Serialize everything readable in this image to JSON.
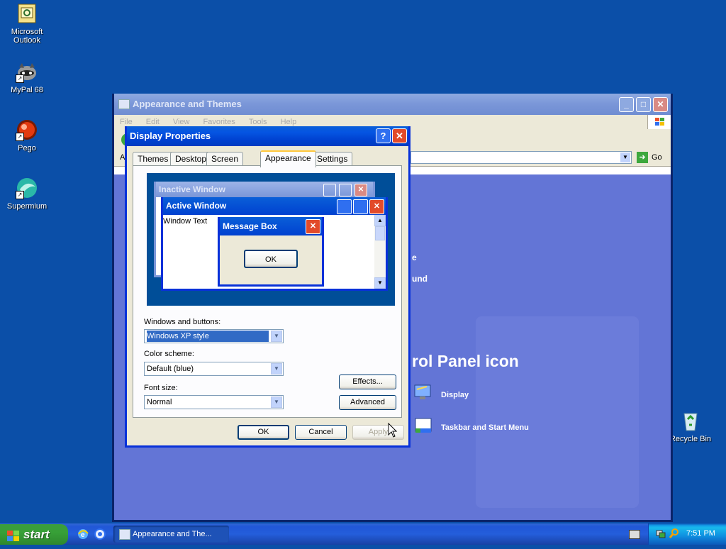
{
  "desktop": {
    "icons": [
      {
        "label": "Microsoft Outlook"
      },
      {
        "label": "MyPal 68"
      },
      {
        "label": "Pego"
      },
      {
        "label": "Supermium"
      },
      {
        "label": "Recycle Bin"
      }
    ]
  },
  "control_panel": {
    "title": "Appearance and Themes",
    "menu": [
      "File",
      "Edit",
      "View",
      "Favorites",
      "Tools",
      "Help"
    ],
    "address_label": "A",
    "go_label": "Go",
    "partial_text_1": "e",
    "partial_text_2": "und",
    "heading": "rol Panel icon",
    "links": [
      {
        "label": "Display"
      },
      {
        "label": "Taskbar and Start Menu"
      }
    ]
  },
  "display_properties": {
    "title": "Display Properties",
    "help_label": "?",
    "tabs": [
      "Themes",
      "Desktop",
      "Screen Saver",
      "Appearance",
      "Settings"
    ],
    "active_tab": "Appearance",
    "preview": {
      "inactive_title": "Inactive Window",
      "active_title": "Active Window",
      "window_text": "Window Text",
      "message_box_title": "Message Box",
      "message_box_ok": "OK"
    },
    "windows_buttons_label": "Windows and buttons:",
    "windows_buttons_value": "Windows XP style",
    "color_scheme_label": "Color scheme:",
    "color_scheme_value": "Default (blue)",
    "font_size_label": "Font size:",
    "font_size_value": "Normal",
    "effects_button": "Effects...",
    "advanced_button": "Advanced",
    "ok_button": "OK",
    "cancel_button": "Cancel",
    "apply_button": "Apply"
  },
  "taskbar": {
    "start_label": "start",
    "task_label": "Appearance and The...",
    "clock": "7:51 PM"
  },
  "colors": {
    "desktop": "#0b4fa8",
    "active_title": "#0055e5",
    "inactive_title": "#7a96d8",
    "taskbar": "#245edb",
    "start_green": "#37a037"
  }
}
